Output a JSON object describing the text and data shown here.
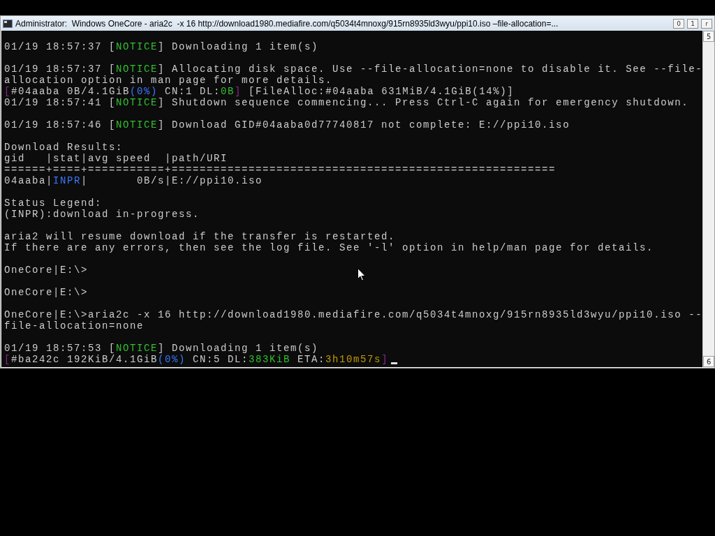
{
  "window": {
    "title": "Administrator:  Windows OneCore - aria2c  -x 16 http://download1980.mediafire.com/q5034t4mnoxg/915rn8935ld3wyu/ppi10.iso –file-allocation=...",
    "controls": [
      "0",
      "1",
      "r"
    ]
  },
  "console": {
    "blocks": [
      {
        "lines": [
          [
            {
              "text": "01/19 18:57:37 ["
            },
            {
              "text": "NOTICE",
              "color": "#2fc12f"
            },
            {
              "text": "] Downloading 1 item(s)"
            }
          ]
        ]
      },
      {
        "lines": [
          [
            {
              "text": "01/19 18:57:37 ["
            },
            {
              "text": "NOTICE",
              "color": "#2fc12f"
            },
            {
              "text": "] Allocating disk space. Use --file-allocation=none to disable it. See --file-"
            }
          ],
          [
            {
              "text": "allocation option in man page for more details."
            }
          ],
          [
            {
              "text": "[",
              "color": "#8a2a8a"
            },
            {
              "text": "#04aaba 0B/4.1GiB"
            },
            {
              "text": "(0%)",
              "color": "#3b78ff"
            },
            {
              "text": " CN:1 DL:"
            },
            {
              "text": "0B",
              "color": "#2fc12f"
            },
            {
              "text": "]",
              "color": "#8a2a8a"
            },
            {
              "text": " [FileAlloc:#04aaba 631MiB/4.1GiB(14%)]"
            }
          ],
          [
            {
              "text": "01/19 18:57:41 ["
            },
            {
              "text": "NOTICE",
              "color": "#2fc12f"
            },
            {
              "text": "] Shutdown sequence commencing... Press Ctrl-C again for emergency shutdown."
            }
          ]
        ]
      },
      {
        "lines": [
          [
            {
              "text": "01/19 18:57:46 ["
            },
            {
              "text": "NOTICE",
              "color": "#2fc12f"
            },
            {
              "text": "] Download GID#04aaba0d77740817 not complete: E://ppi10.iso"
            }
          ]
        ]
      },
      {
        "lines": [
          [
            {
              "text": "Download Results:"
            }
          ],
          [
            {
              "text": "gid   |stat|avg speed  |path/URI"
            }
          ],
          [
            {
              "text": "======+====+===========+======================================================="
            }
          ],
          [
            {
              "text": "04aaba|"
            },
            {
              "text": "INPR",
              "color": "#3b78ff"
            },
            {
              "text": "|       0B/s|E://ppi10.iso"
            }
          ]
        ]
      },
      {
        "lines": [
          [
            {
              "text": "Status Legend:"
            }
          ],
          [
            {
              "text": "(INPR):download in-progress."
            }
          ]
        ]
      },
      {
        "lines": [
          [
            {
              "text": "aria2 will resume download if the transfer is restarted."
            }
          ],
          [
            {
              "text": "If there are any errors, then see the log file. See '-l' option in help/man page for details."
            }
          ]
        ]
      },
      {
        "lines": [
          [
            {
              "text": "OneCore|E:\\>"
            }
          ]
        ]
      },
      {
        "lines": [
          [
            {
              "text": "OneCore|E:\\>"
            }
          ]
        ]
      },
      {
        "lines": [
          [
            {
              "text": "OneCore|E:\\>aria2c -x 16 http://download1980.mediafire.com/q5034t4mnoxg/915rn8935ld3wyu/ppi10.iso --"
            }
          ],
          [
            {
              "text": "file-allocation=none"
            }
          ]
        ]
      },
      {
        "lines": [
          [
            {
              "text": "01/19 18:57:53 ["
            },
            {
              "text": "NOTICE",
              "color": "#2fc12f"
            },
            {
              "text": "] Downloading 1 item(s)"
            }
          ],
          [
            {
              "text": "[",
              "color": "#8a2a8a"
            },
            {
              "text": "#ba242c 192KiB/4.1GiB"
            },
            {
              "text": "(0%)",
              "color": "#3b78ff"
            },
            {
              "text": " CN:5 DL:"
            },
            {
              "text": "383KiB",
              "color": "#2fc12f"
            },
            {
              "text": " ETA:"
            },
            {
              "text": "3h10m57s",
              "color": "#c19c00"
            },
            {
              "text": "]",
              "color": "#8a2a8a"
            }
          ]
        ]
      }
    ]
  },
  "scrollbar": {
    "up": "5",
    "down": "6"
  }
}
